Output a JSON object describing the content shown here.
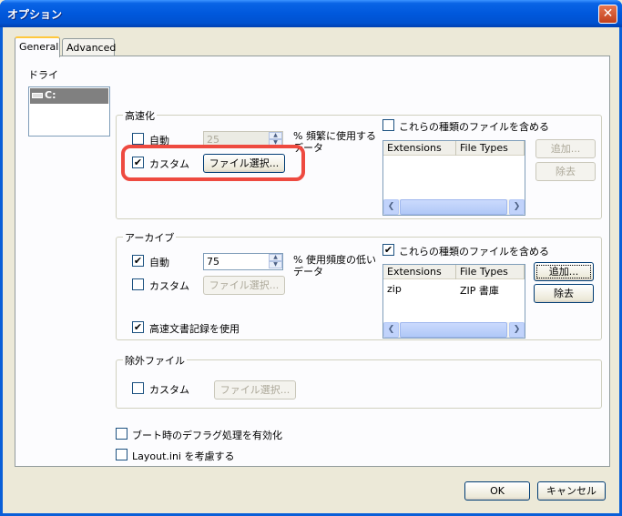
{
  "window": {
    "title": "オプション",
    "close": "✕"
  },
  "tabs": [
    "General",
    "Advanced"
  ],
  "drive": {
    "label": "ドライ",
    "item": "C:"
  },
  "optimize": {
    "label": "高速化",
    "auto_label": "自動",
    "spin_value": "25",
    "spin_caption": "% 頻繁に使用するデータ",
    "custom_label": "カスタム",
    "custom_checked": true,
    "auto_checked": false,
    "include_label": "これらの種類のファイルを含める",
    "include_checked": false,
    "file_button": "ファイル選択...",
    "add_button": "追加...",
    "remove_button": "除去",
    "columns": [
      "Extensions",
      "File Types"
    ],
    "rows": []
  },
  "archive": {
    "label": "アーカイブ",
    "auto_label": "自動",
    "auto_checked": true,
    "spin_value": "75",
    "spin_caption": "% 使用頻度の低いデータ",
    "custom_label": "カスタム",
    "custom_checked": false,
    "file_button": "ファイル選択...",
    "include_label": "これらの種類のファイルを含める",
    "include_checked": true,
    "columns": [
      "Extensions",
      "File Types"
    ],
    "rows": [
      {
        "ext": "zip",
        "type": "ZIP 書庫"
      }
    ],
    "add_button": "追加...",
    "remove_button": "除去",
    "fast_record_label": "高速文書記録を使用",
    "fast_record_checked": true
  },
  "exclude": {
    "label": "除外ファイル",
    "custom_label": "カスタム",
    "custom_checked": false,
    "file_button": "ファイル選択..."
  },
  "boot_defrag_label": "ブート時のデフラグ処理を有効化",
  "layout_ini_label": "Layout.ini を考慮する",
  "footer": {
    "ok": "OK",
    "cancel": "キャンセル"
  },
  "colors": {
    "highlight": "#ee4a40",
    "title_bar": "#0058dc"
  }
}
